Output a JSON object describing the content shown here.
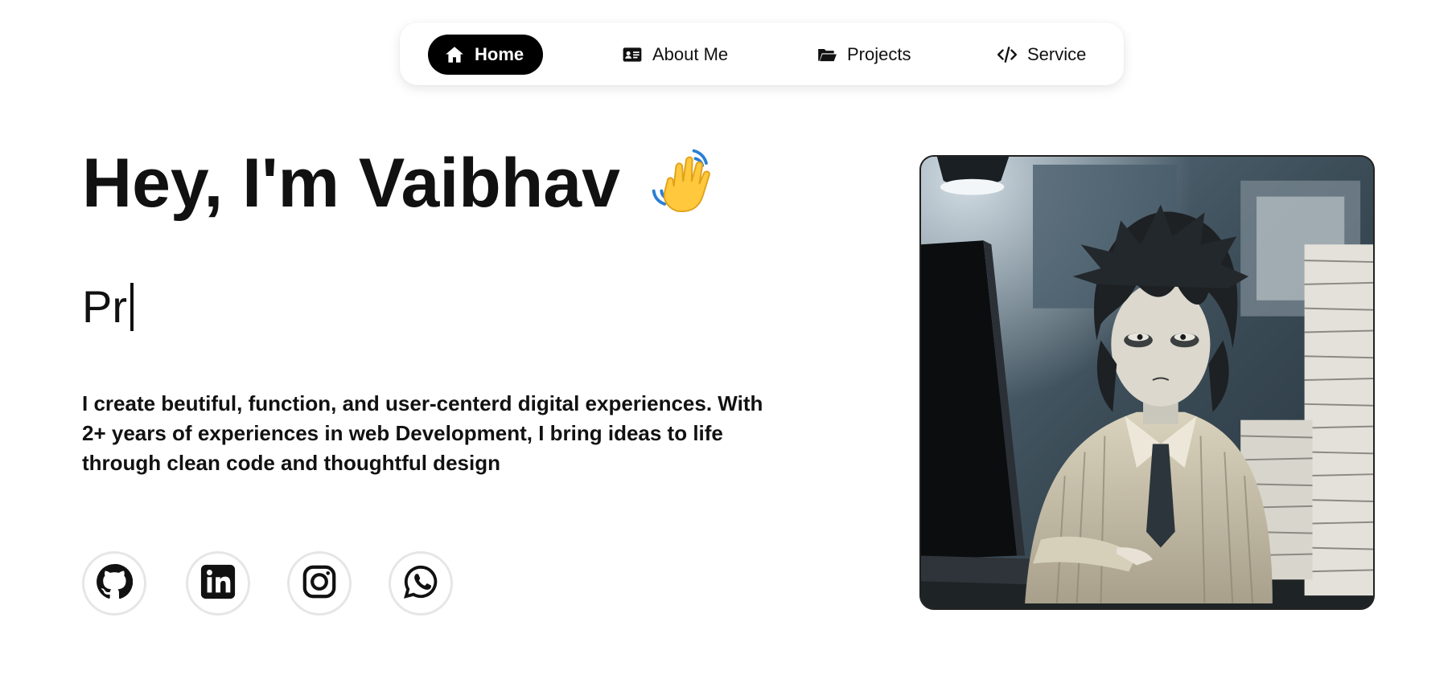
{
  "nav": {
    "items": [
      {
        "label": "Home",
        "icon": "home-icon",
        "active": true
      },
      {
        "label": "About Me",
        "icon": "id-card-icon",
        "active": false
      },
      {
        "label": "Projects",
        "icon": "folder-open-icon",
        "active": false
      },
      {
        "label": "Service",
        "icon": "code-icon",
        "active": false
      }
    ]
  },
  "hero": {
    "title": "Hey, I'm Vaibhav",
    "emoji_icon": "waving-hand-icon",
    "typed_text": "Pr",
    "intro": "I create beutiful, function, and user-centerd digital experiences. With 2+ years of experiences in web Development, I bring ideas to life through clean code and thoughtful design"
  },
  "social": [
    {
      "name": "github-icon"
    },
    {
      "name": "linkedin-icon"
    },
    {
      "name": "instagram-icon"
    },
    {
      "name": "whatsapp-icon"
    }
  ],
  "portrait": {
    "description_icon": "portrait-illustration"
  },
  "colors": {
    "accent": "#000000",
    "background": "#ffffff",
    "social_border": "#e6e6e6"
  }
}
